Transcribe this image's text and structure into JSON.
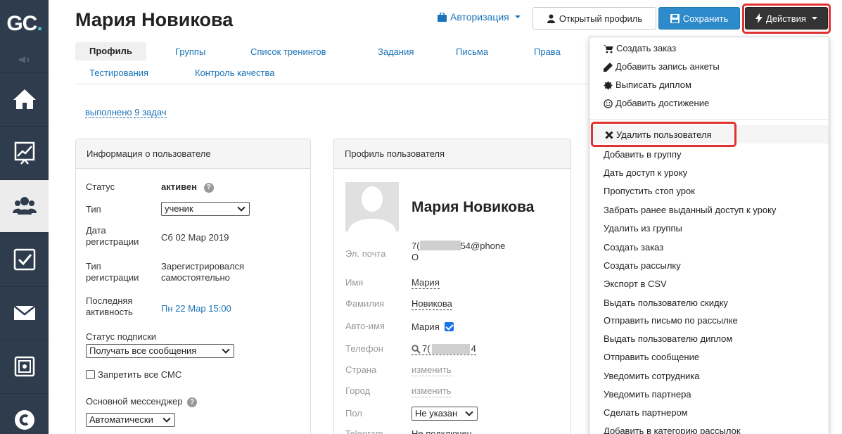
{
  "app": {
    "logo_main": "GC",
    "logo_dot": "."
  },
  "sidebar": {
    "items": [
      {
        "icon": "home-icon"
      },
      {
        "icon": "chart-icon"
      },
      {
        "icon": "users-icon",
        "active": true
      },
      {
        "icon": "tasks-icon"
      },
      {
        "icon": "mail-icon"
      },
      {
        "icon": "safe-icon"
      },
      {
        "icon": "chat-icon"
      }
    ]
  },
  "header": {
    "title": "Мария Новикова",
    "auth_label": "Авторизация",
    "open_profile_label": "Открытый профиль",
    "save_label": "Сохранить",
    "actions_label": "Действия"
  },
  "tabs": [
    "Профиль",
    "Группы",
    "Список тренингов",
    "Задания",
    "Письма",
    "Права",
    "Тестирования",
    "Контроль качества"
  ],
  "tasks_link": "выполнено 9 задач",
  "user_info": {
    "heading": "Информация о пользователе",
    "status_label": "Статус",
    "status_value": "активен",
    "type_label": "Тип",
    "type_value": "ученик",
    "reg_date_label_1": "Дата",
    "reg_date_label_2": "регистрации",
    "reg_date_value": "Сб 02 Мар 2019",
    "reg_type_label_1": "Тип",
    "reg_type_label_2": "регистрации",
    "reg_type_value_1": "Зарегистрировался",
    "reg_type_value_2": "самостоятельно",
    "last_active_label_1": "Последняя",
    "last_active_label_2": "активность",
    "last_active_value": "Пн 22 Мар 15:00",
    "subscription_label": "Статус подписки",
    "subscription_value": "Получать все сообщения",
    "sms_label": "Запретить все СМС",
    "messenger_label": "Основной мессенджер",
    "messenger_value": "Автоматически"
  },
  "profile": {
    "heading": "Профиль пользователя",
    "name": "Мария Новикова",
    "email_label": "Эл. почта",
    "email_prefix": "7(",
    "email_suffix": "54@phone",
    "email_line2": "O",
    "first_name_label": "Имя",
    "first_name_value": "Мария",
    "last_name_label": "Фамилия",
    "last_name_value": "Новикова",
    "autoname_label": "Авто-имя",
    "autoname_value": "Мария",
    "phone_label": "Телефон",
    "phone_prefix": "7(",
    "phone_suffix": "4",
    "country_label": "Страна",
    "country_value": "изменить",
    "city_label": "Город",
    "city_value": "изменить",
    "gender_label": "Пол",
    "gender_value": "Не указан",
    "telegram_label": "Telegram",
    "telegram_value": "Не подключен"
  },
  "actions_menu": {
    "group1": [
      "Создать заказ",
      "Добавить запись анкеты",
      "Выписать диплом",
      "Добавить достижение"
    ],
    "group2": [
      "Удалить пользователя",
      "Добавить в группу",
      "Дать доступ к уроку",
      "Пропустить стоп урок",
      "Забрать ранее выданный доступ к уроку",
      "Удалить из группы",
      "Создать заказ",
      "Создать рассылку",
      "Экспорт в CSV",
      "Выдать пользователю скидку",
      "Отправить письмо по рассылке",
      "Выдать пользователю диплом",
      "Отправить сообщение",
      "Уведомить сотрудника",
      "Уведомить партнера",
      "Сделать партнером",
      "Добавить в категорию рассылок"
    ]
  },
  "colors": {
    "sidebar": "#2e3c4d",
    "link": "#1a73b8",
    "save": "#2d8acb",
    "actions": "#343434",
    "highlight": "#e33131"
  }
}
